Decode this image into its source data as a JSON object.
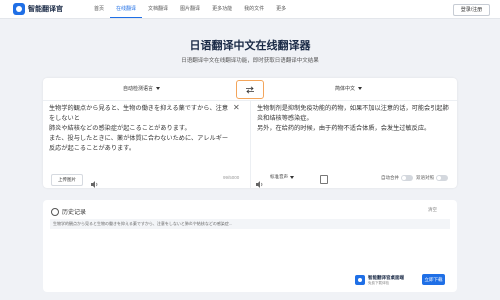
{
  "brand": {
    "name": "智能翻译官"
  },
  "nav": {
    "items": [
      "首页",
      "在线翻译",
      "文档翻译",
      "图片翻译",
      "更多功能",
      "我的文件",
      "更多"
    ]
  },
  "header": {
    "login_label": "登录/注册"
  },
  "hero": {
    "title": "日语翻译中文在线翻译器",
    "subtitle": "日语翻译中文在线翻译功能，即时获取日语翻译中文结果"
  },
  "translator": {
    "source_lang": "自动检测语言",
    "target_lang": "简体中文",
    "source_lines": [
      "生物学的観点から見ると、生物の働きを抑える薬ですから、注意をしないと",
      "肺炎や結核などの感染症が起こることがあります。",
      "また、投与したときに、薬が体質に合わないために、アレルギー",
      "反応が起こることがあります。"
    ],
    "target_lines": [
      "生物制剂是抑制免疫功能的药物，如果不加以注意的话，可能会引起肺",
      "炎和结核等感染症。",
      "另外，在给药的时候，由于药物不适合体质，会发生过敏反应。"
    ],
    "upload_label": "上传图片",
    "char_count": "99/5000",
    "voice_label": "标准音声",
    "toggle_auto_label": "自动合并",
    "toggle_side_label": "双语对照"
  },
  "history": {
    "title": "历史记录",
    "clear_label": "清空",
    "rows": [
      "生物学的観点から見ると生物の働きを抑える薬ですから、注意をしないと肺炎や結核などの感染症..."
    ]
  },
  "promo": {
    "title": "智能翻译官桌面端",
    "subtitle": "免费下载体验",
    "download_label": "立即下载"
  },
  "colors": {
    "accent": "#1f6fe6",
    "swap_border": "#f3a55b",
    "background": "#f0f2f6"
  }
}
